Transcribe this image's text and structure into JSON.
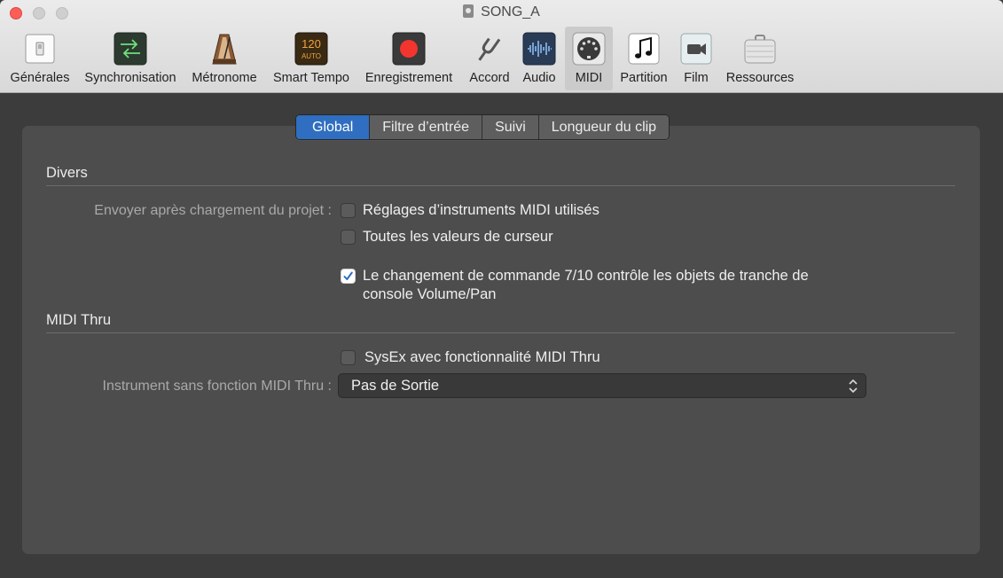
{
  "window": {
    "title": "SONG_A"
  },
  "toolbar": {
    "items": [
      {
        "label": "Générales",
        "icon": "switch-icon"
      },
      {
        "label": "Synchronisation",
        "icon": "sync-arrows-icon"
      },
      {
        "label": "Métronome",
        "icon": "metronome-icon"
      },
      {
        "label": "Smart Tempo",
        "icon": "smart-tempo-icon",
        "icon_text": "120",
        "icon_subtext": "AUTO"
      },
      {
        "label": "Enregistrement",
        "icon": "record-icon"
      },
      {
        "label": "Accord",
        "icon": "tuning-fork-icon"
      },
      {
        "label": "Audio",
        "icon": "waveform-icon"
      },
      {
        "label": "MIDI",
        "icon": "midi-port-icon",
        "selected": true
      },
      {
        "label": "Partition",
        "icon": "music-note-icon"
      },
      {
        "label": "Film",
        "icon": "video-camera-icon"
      },
      {
        "label": "Ressources",
        "icon": "briefcase-icon"
      }
    ]
  },
  "tabs": [
    {
      "label": "Global",
      "active": true
    },
    {
      "label": "Filtre d’entrée"
    },
    {
      "label": "Suivi"
    },
    {
      "label": "Longueur du clip"
    }
  ],
  "sections": {
    "divers": {
      "title": "Divers",
      "send_label": "Envoyer après chargement du projet :",
      "options": [
        {
          "label": "Réglages d’instruments MIDI utilisés",
          "checked": false
        },
        {
          "label": "Toutes les valeurs de curseur",
          "checked": false
        }
      ],
      "cc_option": {
        "line1": "Le changement de commande 7/10 contrôle les objets de tranche de",
        "line2": "console Volume/Pan",
        "checked": true
      }
    },
    "midi_thru": {
      "title": "MIDI Thru",
      "sysex_label": "SysEx avec fonctionnalité MIDI Thru",
      "sysex_checked": false,
      "instrument_label": "Instrument sans fonction MIDI Thru :",
      "instrument_value": "Pas de Sortie"
    }
  },
  "colors": {
    "accent": "#2f6ec0",
    "close": "#fc5f57",
    "panel": "#4d4d4d",
    "background": "#3c3c3c"
  }
}
